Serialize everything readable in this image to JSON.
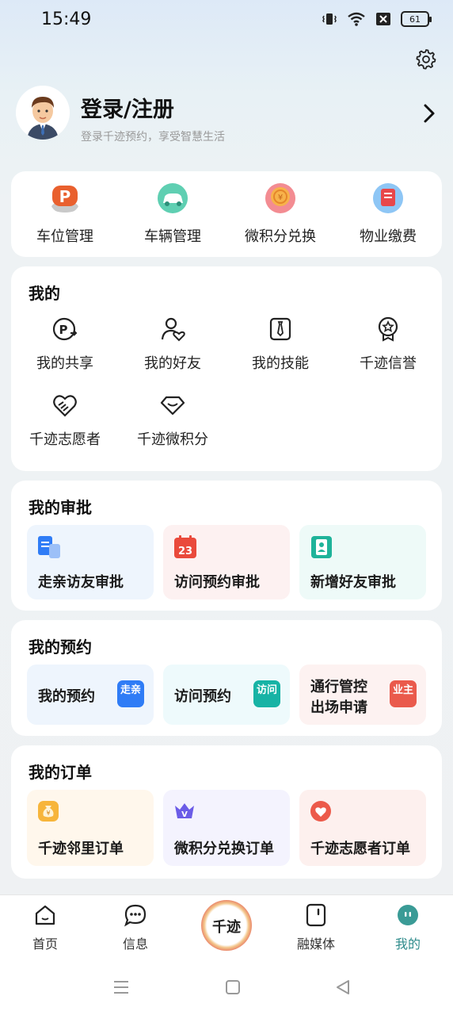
{
  "status": {
    "time": "15:49",
    "battery": "61"
  },
  "profile": {
    "title": "登录/注册",
    "subtitle": "登录千迹预约，享受智慧生活"
  },
  "quick": [
    {
      "label": "车位管理",
      "icon": "parking-icon",
      "color": "#e9602e"
    },
    {
      "label": "车辆管理",
      "icon": "car-icon",
      "color": "#49c2a5"
    },
    {
      "label": "微积分兑换",
      "icon": "coin-icon",
      "color": "#ef6b77"
    },
    {
      "label": "物业缴费",
      "icon": "bill-icon",
      "color": "#e8474a"
    }
  ],
  "mine": {
    "title": "我的",
    "items": [
      {
        "label": "我的共享",
        "icon": "parking-share-icon"
      },
      {
        "label": "我的好友",
        "icon": "friend-icon"
      },
      {
        "label": "我的技能",
        "icon": "tie-icon"
      },
      {
        "label": "千迹信誉",
        "icon": "badge-icon"
      },
      {
        "label": "千迹志愿者",
        "icon": "volunteer-heart-icon"
      },
      {
        "label": "千迹微积分",
        "icon": "points-icon"
      }
    ]
  },
  "approval": {
    "title": "我的审批",
    "items": [
      {
        "label": "走亲访友审批",
        "icon": "document-icon"
      },
      {
        "label": "访问预约审批",
        "icon": "calendar-icon",
        "icon_text": "23"
      },
      {
        "label": "新增好友审批",
        "icon": "contact-icon"
      }
    ]
  },
  "reserve": {
    "title": "我的预约",
    "items": [
      {
        "label": "我的预约",
        "badge": "走亲"
      },
      {
        "label": "访问预约",
        "badge": "访问"
      },
      {
        "label_line1": "通行管控",
        "label_line2": "出场申请",
        "badge": "业主"
      }
    ]
  },
  "orders": {
    "title": "我的订单",
    "items": [
      {
        "label": "千迹邻里订单",
        "icon": "money-bag-icon"
      },
      {
        "label": "微积分兑换订单",
        "icon": "crown-icon"
      },
      {
        "label": "千迹志愿者订单",
        "icon": "heart-icon"
      }
    ]
  },
  "tabs": [
    {
      "label": "首页"
    },
    {
      "label": "信息"
    },
    {
      "label": "融媒体"
    },
    {
      "label": "我的"
    }
  ],
  "center_logo_text": "千迹",
  "colors": {
    "active_tab": "#2e8b8b",
    "accent_blue": "#2f7cf6"
  }
}
